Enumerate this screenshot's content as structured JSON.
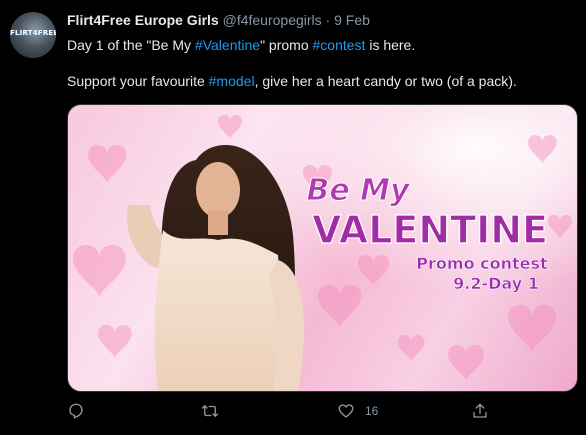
{
  "tweet": {
    "author_name": "Flirt4Free Europe Girls",
    "handle": "@f4feuropegirls",
    "separator": "·",
    "date": "9 Feb",
    "avatar_text": "FLIRT4FREE",
    "text_line1": {
      "pre": "Day 1 of the \"Be My ",
      "tag1": "#Valentine",
      "mid": "\" promo ",
      "tag2": "#contest",
      "post": " is here."
    },
    "text_line2": {
      "pre": "Support your favourite ",
      "tag": "#model",
      "post": ", give her a heart candy or two (of a pack)."
    },
    "media": {
      "line1": "Be My",
      "line2": "VALENTINE",
      "line3": "Promo contest",
      "line4": "9.2-Day 1"
    },
    "actions": {
      "reply_icon": "reply-icon",
      "retweet_icon": "retweet-icon",
      "like_icon": "heart-icon",
      "like_count": "16",
      "share_icon": "share-icon"
    }
  },
  "colors": {
    "background": "#000000",
    "link": "#1d9bf0",
    "secondary_text": "#8b98a5",
    "primary_text": "#e7e9ea",
    "valentine_purple": "#a02ca6"
  }
}
